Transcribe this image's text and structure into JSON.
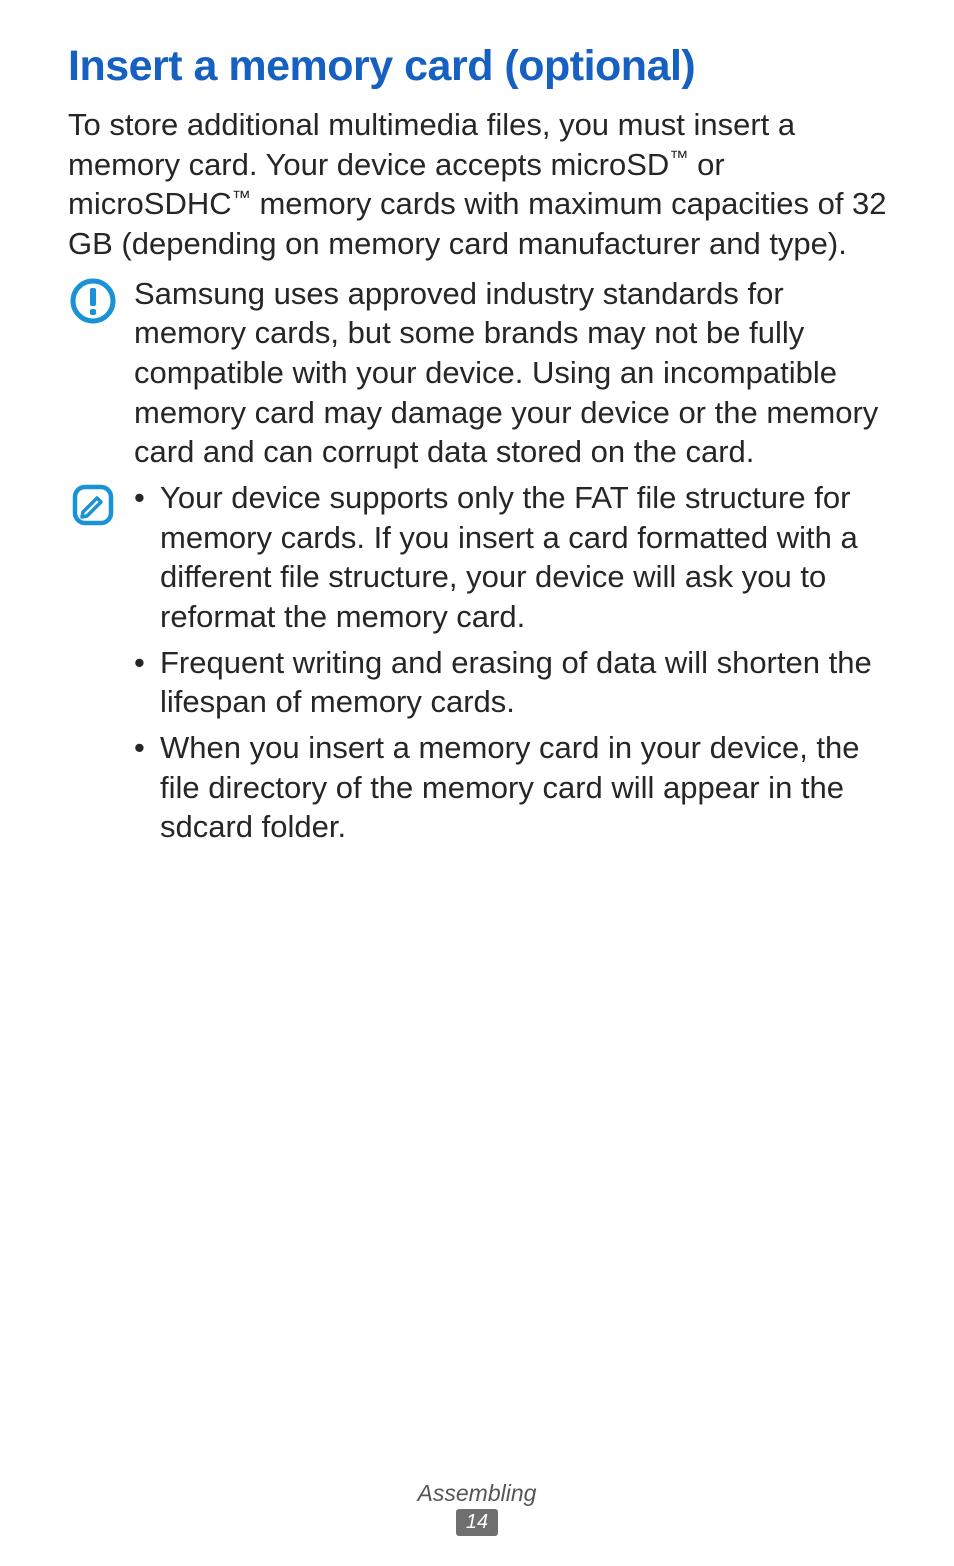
{
  "title": "Insert a memory card (optional)",
  "intro_parts": {
    "p1": "To store additional multimedia files, you must insert a memory card. Your device accepts microSD",
    "p2": " or microSDHC",
    "p3": " memory cards with maximum capacities of 32 GB (depending on memory card manufacturer and type).",
    "tm": "™"
  },
  "caution_text": "Samsung uses approved industry standards for memory cards, but some brands may not be fully compatible with your device. Using an incompatible memory card may damage your device or the memory card and can corrupt data stored on the card.",
  "note_bullets": [
    "Your device supports only the FAT file structure for memory cards. If you insert a card formatted with a different file structure, your device will ask you to reformat the memory card.",
    "Frequent writing and erasing of data will shorten the lifespan of memory cards.",
    "When you insert a memory card in your device, the file directory of the memory card will appear in the sdcard folder."
  ],
  "footer": {
    "section": "Assembling",
    "page": "14"
  }
}
